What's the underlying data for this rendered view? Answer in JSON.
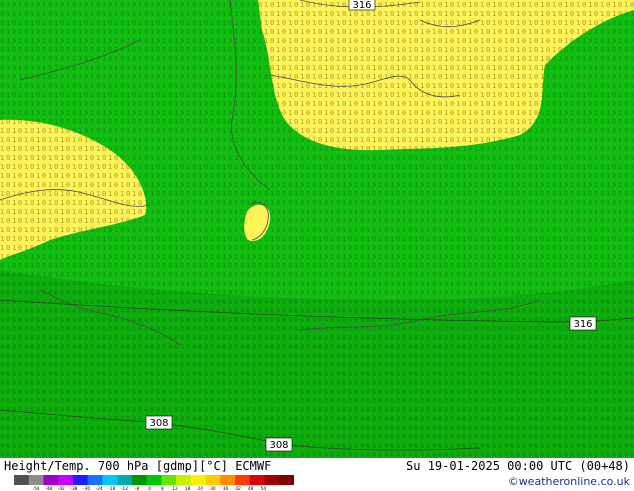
{
  "map": {
    "contour_labels": [
      {
        "id": "316-top",
        "text": "316"
      },
      {
        "id": "316-right",
        "text": "316"
      },
      {
        "id": "308-left",
        "text": "308"
      },
      {
        "id": "308-bottom",
        "text": "308"
      }
    ],
    "colors": {
      "field_green": "#12be12",
      "field_light": "#1ed01e",
      "field_warm": "#fff35a",
      "coast": "#4a4a4a"
    }
  },
  "footer": {
    "title": "Height/Temp. 700 hPa [gdmp][°C] ECMWF",
    "datetime": "Su 19-01-2025 00:00 UTC (00+48)",
    "credit": "©weatheronline.co.uk",
    "scale_ticks": [
      "-54",
      "-48",
      "-42",
      "-38",
      "-30",
      "-24",
      "-18",
      "-12",
      "-8",
      "0",
      "8",
      "12",
      "18",
      "24",
      "30",
      "36",
      "42",
      "48",
      "54"
    ],
    "scale_colors": [
      "#505050",
      "#8c8c8c",
      "#a000c8",
      "#c800ff",
      "#1e1eff",
      "#1e6eff",
      "#00c8ff",
      "#00aaaa",
      "#009600",
      "#00c800",
      "#64e600",
      "#c8f000",
      "#fff000",
      "#ffc800",
      "#ff8c00",
      "#ff3c00",
      "#dc0000",
      "#a00000",
      "#780000"
    ]
  }
}
